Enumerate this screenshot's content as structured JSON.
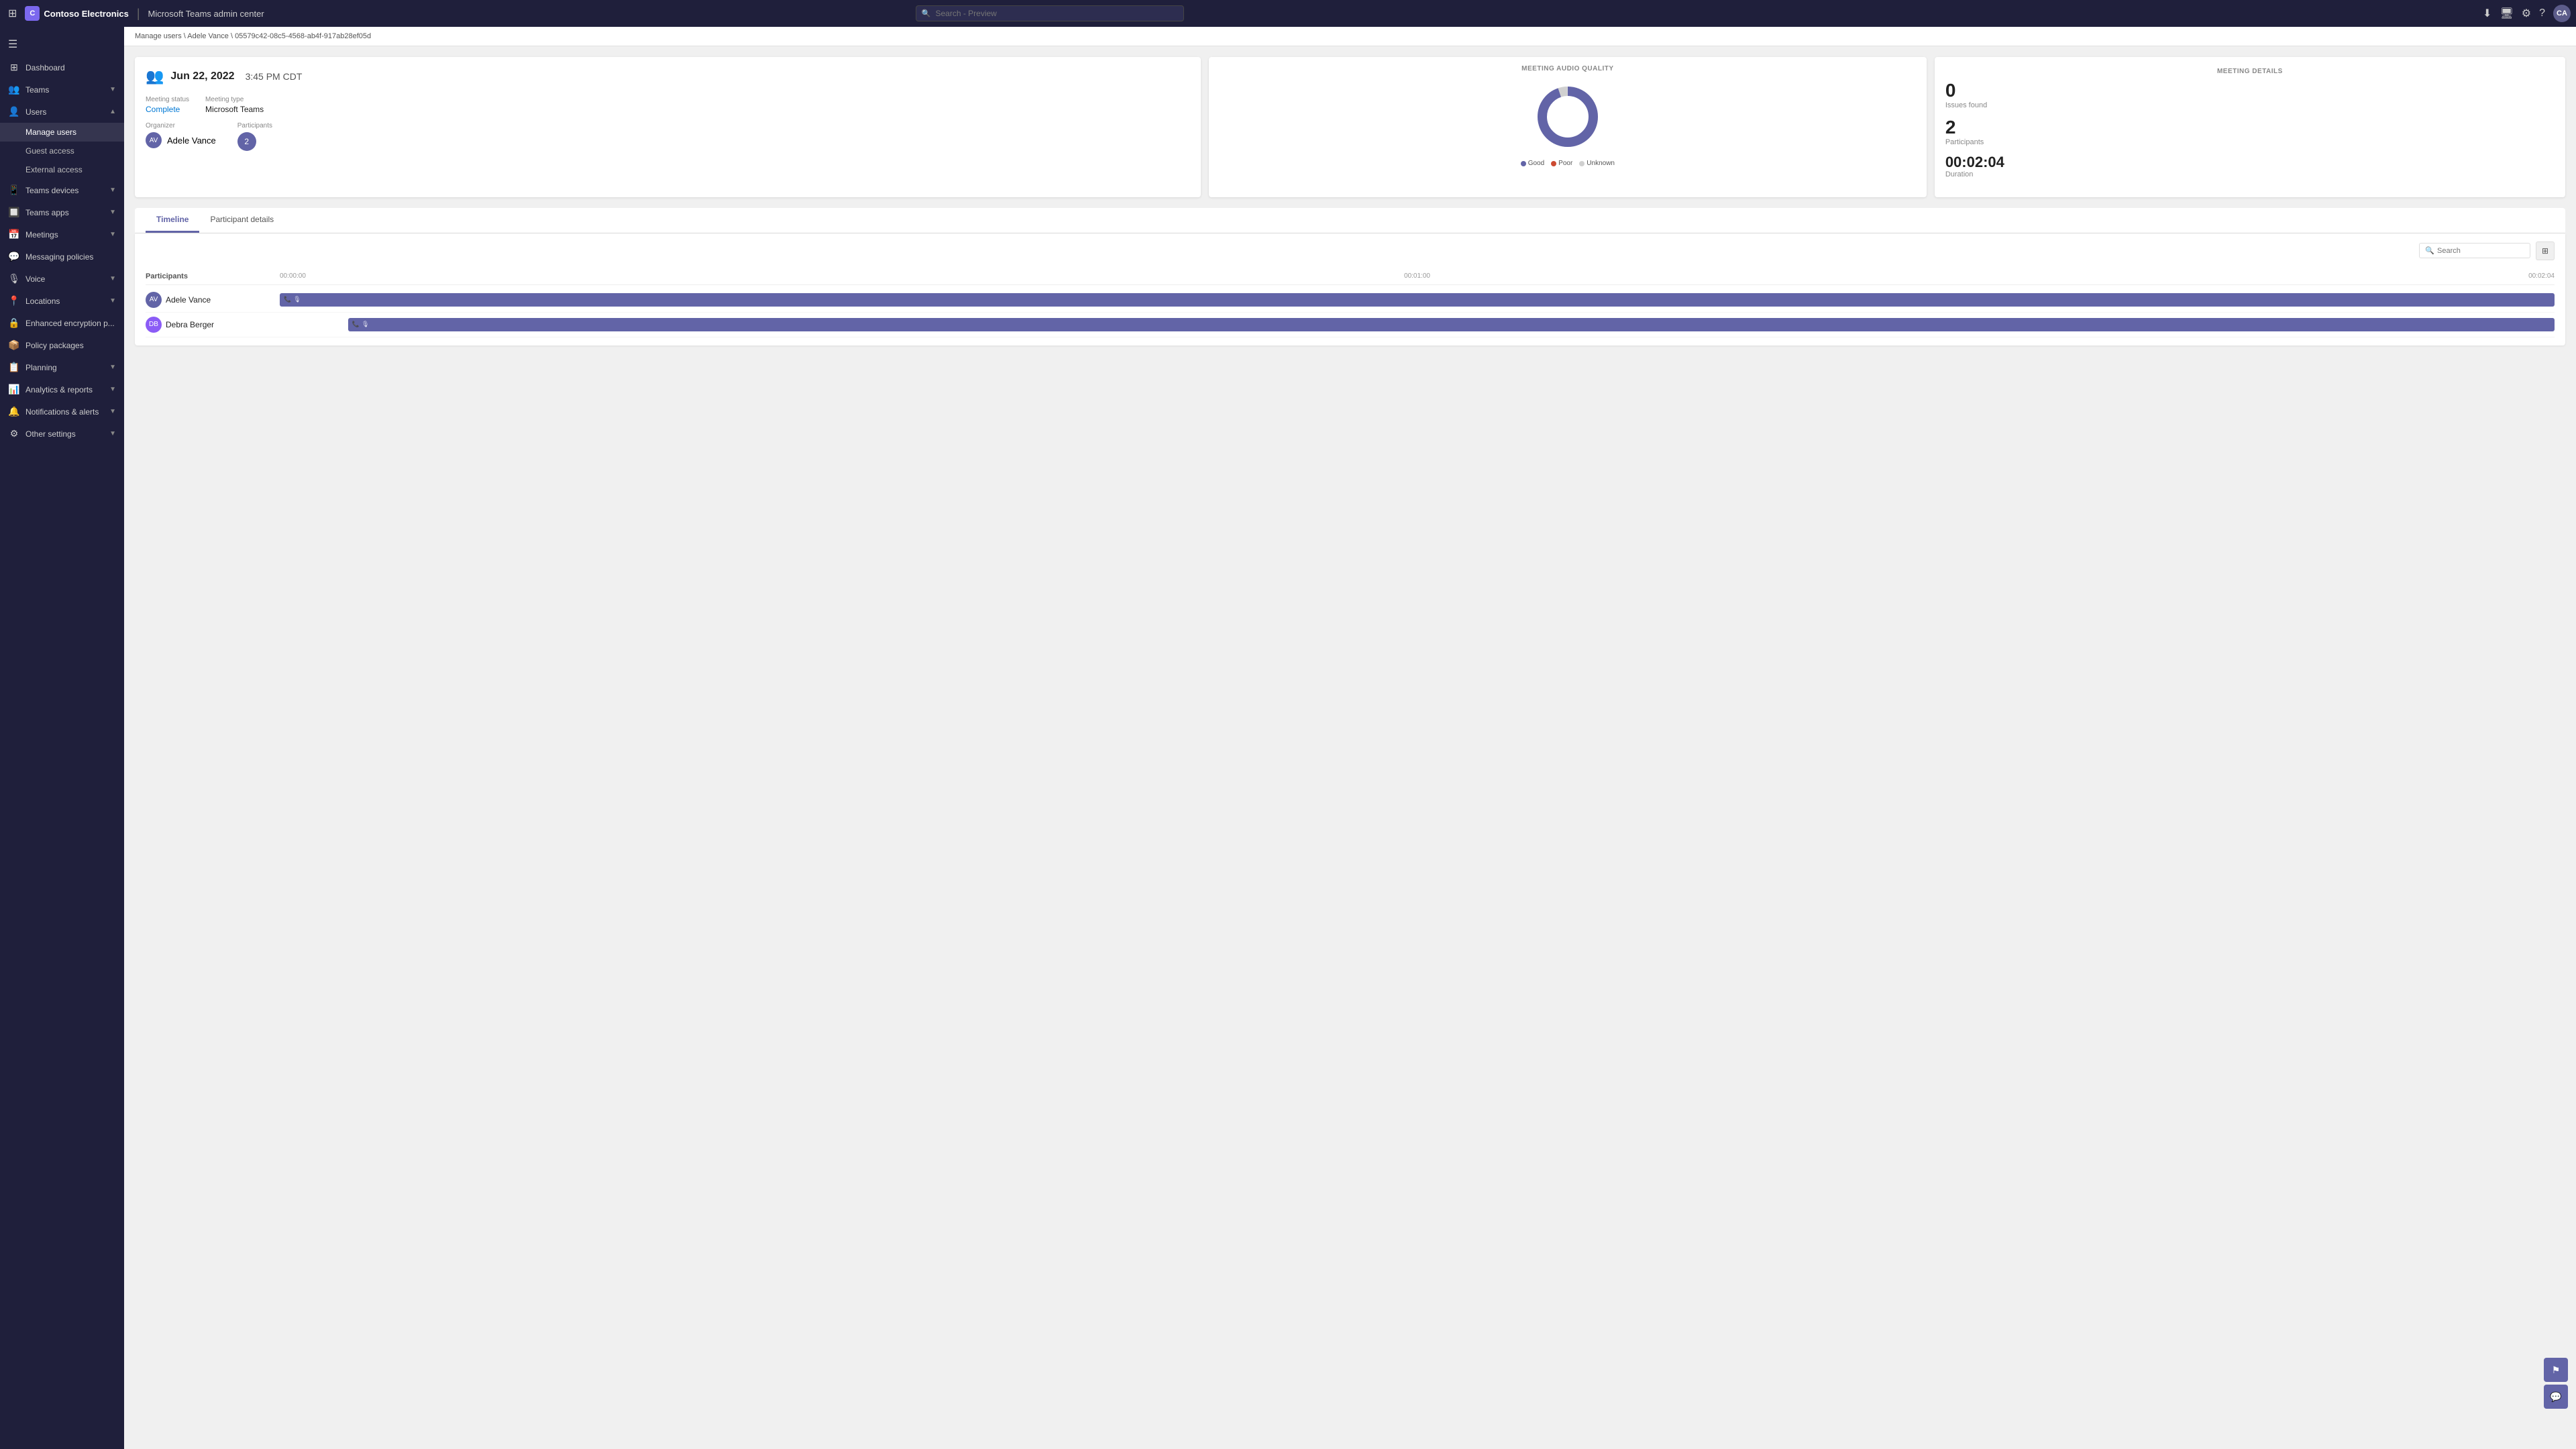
{
  "topbar": {
    "brand": "Contoso Electronics",
    "app_name": "Microsoft Teams admin center",
    "search_placeholder": "Search - Preview",
    "user_initials": "CA"
  },
  "breadcrumb": {
    "parts": [
      "Manage users",
      "Adele Vance",
      "05579c42-08c5-4568-ab4f-917ab28ef05d"
    ]
  },
  "meeting_card": {
    "date": "Jun 22, 2022",
    "time": "3:45 PM CDT",
    "meeting_status_label": "Meeting status",
    "meeting_status_value": "Complete",
    "meeting_type_label": "Meeting type",
    "meeting_type_value": "Microsoft Teams",
    "organizer_label": "Organizer",
    "organizer_name": "Adele Vance",
    "participants_label": "Participants",
    "participants_count": "2"
  },
  "audio_quality_card": {
    "title": "MEETING AUDIO QUALITY",
    "donut": {
      "good_pct": 95,
      "poor_pct": 0,
      "unknown_pct": 5
    },
    "legend": {
      "good": "Good",
      "poor": "Poor",
      "unknown": "Unknown"
    },
    "colors": {
      "good": "#6264a7",
      "poor": "#cc4a31",
      "unknown": "#d0d0d0"
    }
  },
  "meeting_details_card": {
    "title": "MEETING DETAILS",
    "issues_count": "0",
    "issues_label": "Issues found",
    "participants_count": "2",
    "participants_label": "Participants",
    "duration": "00:02:04",
    "duration_label": "Duration"
  },
  "tabs": {
    "items": [
      {
        "id": "timeline",
        "label": "Timeline",
        "active": true
      },
      {
        "id": "participant-details",
        "label": "Participant details",
        "active": false
      }
    ]
  },
  "timeline": {
    "search_placeholder": "Search",
    "columns": {
      "participants": "Participants",
      "time_start": "00:00:00",
      "time_mid": "00:01:00",
      "time_end": "00:02:04"
    },
    "participants": [
      {
        "name": "Adele Vance",
        "initials": "AV",
        "bar_start_pct": 0,
        "bar_width_pct": 100
      },
      {
        "name": "Debra Berger",
        "initials": "DB",
        "bar_start_pct": 3,
        "bar_width_pct": 97
      }
    ]
  },
  "sidebar": {
    "items": [
      {
        "id": "dashboard",
        "label": "Dashboard",
        "icon": "⊞",
        "has_children": false
      },
      {
        "id": "teams",
        "label": "Teams",
        "icon": "👥",
        "has_children": true
      },
      {
        "id": "users",
        "label": "Users",
        "icon": "👤",
        "has_children": true,
        "expanded": true
      },
      {
        "id": "teams-devices",
        "label": "Teams devices",
        "icon": "📱",
        "has_children": true
      },
      {
        "id": "teams-apps",
        "label": "Teams apps",
        "icon": "🔲",
        "has_children": true
      },
      {
        "id": "meetings",
        "label": "Meetings",
        "icon": "📅",
        "has_children": true
      },
      {
        "id": "messaging-policies",
        "label": "Messaging policies",
        "icon": "💬",
        "has_children": false
      },
      {
        "id": "voice",
        "label": "Voice",
        "icon": "🎙️",
        "has_children": true
      },
      {
        "id": "locations",
        "label": "Locations",
        "icon": "📍",
        "has_children": true
      },
      {
        "id": "enhanced-encryption",
        "label": "Enhanced encryption p...",
        "icon": "🔒",
        "has_children": false
      },
      {
        "id": "policy-packages",
        "label": "Policy packages",
        "icon": "📦",
        "has_children": false
      },
      {
        "id": "planning",
        "label": "Planning",
        "icon": "📋",
        "has_children": true
      },
      {
        "id": "analytics",
        "label": "Analytics & reports",
        "icon": "📊",
        "has_children": true
      },
      {
        "id": "notifications",
        "label": "Notifications & alerts",
        "icon": "🔔",
        "has_children": true
      },
      {
        "id": "other-settings",
        "label": "Other settings",
        "icon": "⚙️",
        "has_children": true
      }
    ],
    "sub_items": [
      {
        "id": "manage-users",
        "label": "Manage users",
        "active": true
      },
      {
        "id": "guest-access",
        "label": "Guest access"
      },
      {
        "id": "external-access",
        "label": "External access"
      }
    ]
  },
  "floating": {
    "btn1": "⚑",
    "btn2": "💬"
  }
}
